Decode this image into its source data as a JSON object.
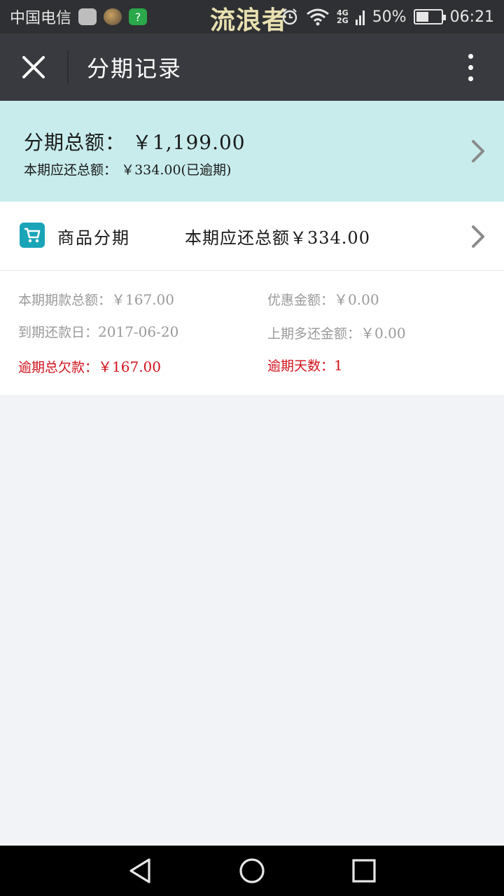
{
  "status_bar": {
    "carrier": "中国电信",
    "watermark": "流浪者",
    "network_top": "4G",
    "network_bottom": "2G",
    "battery_percent": "50%",
    "battery_level": 0.5,
    "time": "06:21"
  },
  "app_bar": {
    "title": "分期记录"
  },
  "summary": {
    "total_label": "分期总额：",
    "total_amount": "￥1,199.00",
    "due_label": "本期应还总额：",
    "due_amount": "￥334.00(已逾期)"
  },
  "card": {
    "title": "商品分期",
    "due_label": "本期应还总额",
    "due_amount": "￥334.00",
    "details": {
      "period_amount_label": "本期期款总额：",
      "period_amount_value": "￥167.00",
      "discount_label": "优惠金额：",
      "discount_value": "￥0.00",
      "due_date_label": "到期还款日：",
      "due_date_value": "2017-06-20",
      "overpaid_label": "上期多还金额：",
      "overpaid_value": "￥0.00",
      "overdue_total_label": "逾期总欠款：",
      "overdue_total_value": "￥167.00",
      "overdue_days_label": "逾期天数：",
      "overdue_days_value": "1"
    }
  },
  "colors": {
    "app_bar": "#393a3f",
    "summary_bg": "#c8ecec",
    "overdue_red": "#d0121b",
    "cart_icon": "#1aa4b8"
  },
  "icons": {
    "close": "close-icon",
    "more": "more-vertical-icon",
    "cart": "shopping-cart-icon",
    "chevron": "chevron-right-icon",
    "back": "back-triangle-icon",
    "home": "home-circle-icon",
    "recents": "recents-square-icon"
  }
}
